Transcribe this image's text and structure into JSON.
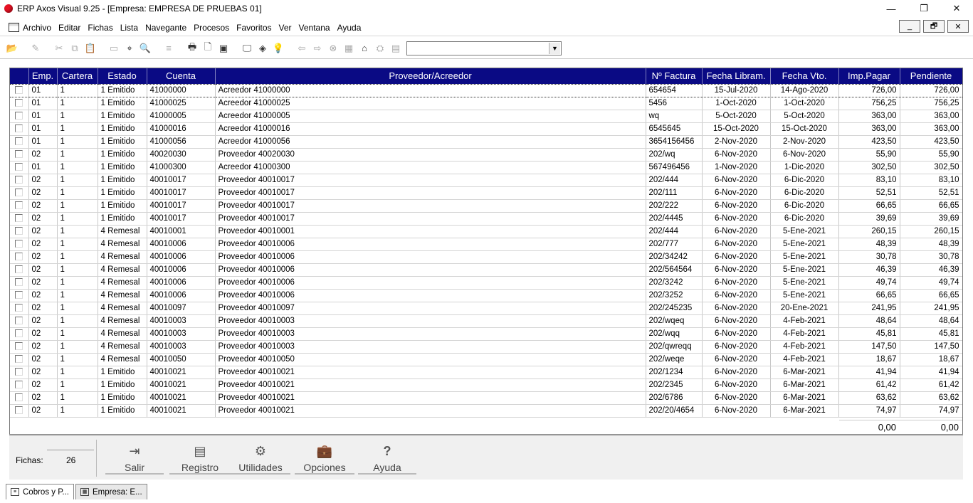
{
  "window": {
    "title": "ERP Axos Visual 9.25 - [Empresa: EMPRESA DE PRUEBAS 01]",
    "min": "—",
    "restore": "❐",
    "close": "✕"
  },
  "menu": [
    "Archivo",
    "Editar",
    "Fichas",
    "Lista",
    "Navegante",
    "Procesos",
    "Favoritos",
    "Ver",
    "Ventana",
    "Ayuda"
  ],
  "mdi": {
    "min": "_",
    "restore": "🗗",
    "close": "✕"
  },
  "columns": [
    "",
    "Emp.",
    "Cartera",
    "Estado",
    "Cuenta",
    "Proveedor/Acreedor",
    "Nº Factura",
    "Fecha Libram.",
    "Fecha Vto.",
    "Imp.Pagar",
    "Pendiente"
  ],
  "rows": [
    [
      "01",
      "1",
      "1 Emitido",
      "41000000",
      "Acreedor 41000000",
      "654654",
      "15-Jul-2020",
      "14-Ago-2020",
      "726,00",
      "726,00"
    ],
    [
      "01",
      "1",
      "1 Emitido",
      "41000025",
      "Acreedor 41000025",
      "5456",
      "1-Oct-2020",
      "1-Oct-2020",
      "756,25",
      "756,25"
    ],
    [
      "01",
      "1",
      "1 Emitido",
      "41000005",
      "Acreedor 41000005",
      "wq",
      "5-Oct-2020",
      "5-Oct-2020",
      "363,00",
      "363,00"
    ],
    [
      "01",
      "1",
      "1 Emitido",
      "41000016",
      "Acreedor 41000016",
      "6545645",
      "15-Oct-2020",
      "15-Oct-2020",
      "363,00",
      "363,00"
    ],
    [
      "01",
      "1",
      "1 Emitido",
      "41000056",
      "Acreedor 41000056",
      "3654156456",
      "2-Nov-2020",
      "2-Nov-2020",
      "423,50",
      "423,50"
    ],
    [
      "02",
      "1",
      "1 Emitido",
      "40020030",
      "Proveedor 40020030",
      "202/wq",
      "6-Nov-2020",
      "6-Nov-2020",
      "55,90",
      "55,90"
    ],
    [
      "01",
      "1",
      "1 Emitido",
      "41000300",
      "Acreedor 41000300",
      "567496456",
      "1-Nov-2020",
      "1-Dic-2020",
      "302,50",
      "302,50"
    ],
    [
      "02",
      "1",
      "1 Emitido",
      "40010017",
      "Proveedor 40010017",
      "202/444",
      "6-Nov-2020",
      "6-Dic-2020",
      "83,10",
      "83,10"
    ],
    [
      "02",
      "1",
      "1 Emitido",
      "40010017",
      "Proveedor 40010017",
      "202/111",
      "6-Nov-2020",
      "6-Dic-2020",
      "52,51",
      "52,51"
    ],
    [
      "02",
      "1",
      "1 Emitido",
      "40010017",
      "Proveedor 40010017",
      "202/222",
      "6-Nov-2020",
      "6-Dic-2020",
      "66,65",
      "66,65"
    ],
    [
      "02",
      "1",
      "1 Emitido",
      "40010017",
      "Proveedor 40010017",
      "202/4445",
      "6-Nov-2020",
      "6-Dic-2020",
      "39,69",
      "39,69"
    ],
    [
      "02",
      "1",
      "4 Remesal",
      "40010001",
      "Proveedor 40010001",
      "202/444",
      "6-Nov-2020",
      "5-Ene-2021",
      "260,15",
      "260,15"
    ],
    [
      "02",
      "1",
      "4 Remesal",
      "40010006",
      "Proveedor 40010006",
      "202/777",
      "6-Nov-2020",
      "5-Ene-2021",
      "48,39",
      "48,39"
    ],
    [
      "02",
      "1",
      "4 Remesal",
      "40010006",
      "Proveedor 40010006",
      "202/34242",
      "6-Nov-2020",
      "5-Ene-2021",
      "30,78",
      "30,78"
    ],
    [
      "02",
      "1",
      "4 Remesal",
      "40010006",
      "Proveedor 40010006",
      "202/564564",
      "6-Nov-2020",
      "5-Ene-2021",
      "46,39",
      "46,39"
    ],
    [
      "02",
      "1",
      "4 Remesal",
      "40010006",
      "Proveedor 40010006",
      "202/3242",
      "6-Nov-2020",
      "5-Ene-2021",
      "49,74",
      "49,74"
    ],
    [
      "02",
      "1",
      "4 Remesal",
      "40010006",
      "Proveedor 40010006",
      "202/3252",
      "6-Nov-2020",
      "5-Ene-2021",
      "66,65",
      "66,65"
    ],
    [
      "02",
      "1",
      "4 Remesal",
      "40010097",
      "Proveedor 40010097",
      "202/245235",
      "6-Nov-2020",
      "20-Ene-2021",
      "241,95",
      "241,95"
    ],
    [
      "02",
      "1",
      "4 Remesal",
      "40010003",
      "Proveedor 40010003",
      "202/wqeq",
      "6-Nov-2020",
      "4-Feb-2021",
      "48,64",
      "48,64"
    ],
    [
      "02",
      "1",
      "4 Remesal",
      "40010003",
      "Proveedor 40010003",
      "202/wqq",
      "6-Nov-2020",
      "4-Feb-2021",
      "45,81",
      "45,81"
    ],
    [
      "02",
      "1",
      "4 Remesal",
      "40010003",
      "Proveedor 40010003",
      "202/qwreqq",
      "6-Nov-2020",
      "4-Feb-2021",
      "147,50",
      "147,50"
    ],
    [
      "02",
      "1",
      "4 Remesal",
      "40010050",
      "Proveedor 40010050",
      "202/weqe",
      "6-Nov-2020",
      "4-Feb-2021",
      "18,67",
      "18,67"
    ],
    [
      "02",
      "1",
      "1 Emitido",
      "40010021",
      "Proveedor 40010021",
      "202/1234",
      "6-Nov-2020",
      "6-Mar-2021",
      "41,94",
      "41,94"
    ],
    [
      "02",
      "1",
      "1 Emitido",
      "40010021",
      "Proveedor 40010021",
      "202/2345",
      "6-Nov-2020",
      "6-Mar-2021",
      "61,42",
      "61,42"
    ],
    [
      "02",
      "1",
      "1 Emitido",
      "40010021",
      "Proveedor 40010021",
      "202/6786",
      "6-Nov-2020",
      "6-Mar-2021",
      "63,62",
      "63,62"
    ],
    [
      "02",
      "1",
      "1 Emitido",
      "40010021",
      "Proveedor 40010021",
      "202/20/4654",
      "6-Nov-2020",
      "6-Mar-2021",
      "74,97",
      "74,97"
    ]
  ],
  "totals": {
    "imp_pagar": "0,00",
    "pendiente": "0,00"
  },
  "footer": {
    "fichas_label": "Fichas:",
    "fichas_value": "26"
  },
  "buttons": [
    {
      "name": "salir",
      "label": "Salir",
      "icon": "exit-icon"
    },
    {
      "name": "registro",
      "label": "Registro",
      "icon": "document-icon"
    },
    {
      "name": "utilidades",
      "label": "Utilidades",
      "icon": "gear-icon"
    },
    {
      "name": "opciones",
      "label": "Opciones",
      "icon": "briefcase-icon"
    },
    {
      "name": "ayuda",
      "label": "Ayuda",
      "icon": "help-icon"
    }
  ],
  "tabs": [
    {
      "label": "Cobros y P...",
      "active": false
    },
    {
      "label": "Empresa: E...",
      "active": true
    }
  ],
  "toolbar_icons": [
    "open-folder-icon",
    "edit-icon",
    "cut-icon",
    "copy-icon",
    "paste-icon",
    "window-icon",
    "find-icon",
    "search-icon",
    "attach-icon",
    "print-icon",
    "print-preview-icon",
    "export-icon",
    "screen-icon",
    "tag-icon",
    "help-icon",
    "back-icon",
    "forward-icon",
    "cancel-icon",
    "calc-icon",
    "home-icon",
    "network-icon",
    "report-icon"
  ]
}
